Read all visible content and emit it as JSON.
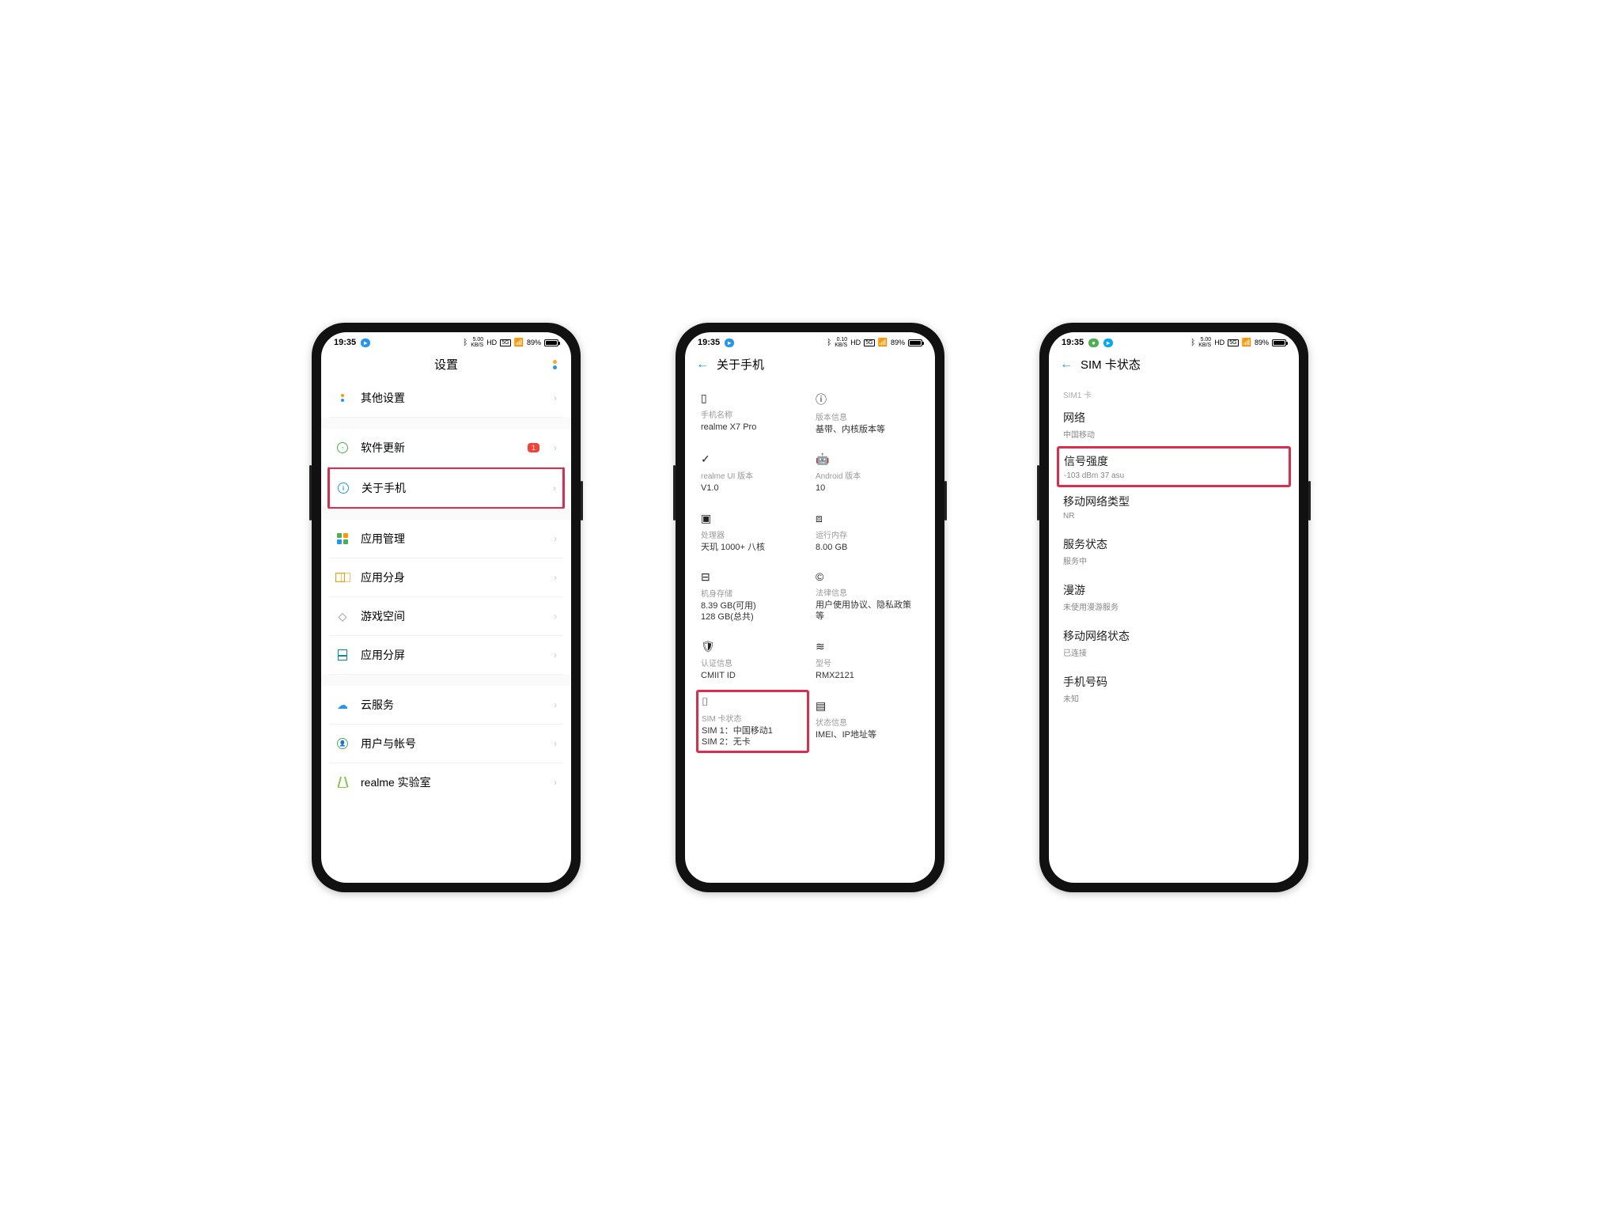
{
  "status": {
    "time": "19:35",
    "net_speed_top": "5.00",
    "net_speed_top_alt": "0.10",
    "net_speed_unit": "KB/S",
    "hd": "HD",
    "fiveg": "5G",
    "battery_pct": "89%"
  },
  "phone1": {
    "title": "设置",
    "rows": {
      "other": "其他设置",
      "update": "软件更新",
      "update_badge": "1",
      "about": "关于手机",
      "app_mgmt": "应用管理",
      "app_clone": "应用分身",
      "game_space": "游戏空间",
      "split_screen": "应用分屏",
      "cloud": "云服务",
      "accounts": "用户与帐号",
      "lab": "realme 实验室"
    }
  },
  "phone2": {
    "title": "关于手机",
    "cells": {
      "name_t": "手机名称",
      "name_v": "realme X7 Pro",
      "ver_t": "版本信息",
      "ver_v": "基带、内核版本等",
      "ui_t": "realme UI 版本",
      "ui_v": "V1.0",
      "android_t": "Android 版本",
      "android_v": "10",
      "cpu_t": "处理器",
      "cpu_v": "天玑 1000+ 八核",
      "ram_t": "运行内存",
      "ram_v": "8.00 GB",
      "storage_t": "机身存储",
      "storage_v1": "8.39 GB(可用)",
      "storage_v2": "128 GB(总共)",
      "legal_t": "法律信息",
      "legal_v": "用户使用协议、隐私政策等",
      "cert_t": "认证信息",
      "cert_v": "CMIIT ID",
      "model_t": "型号",
      "model_v": "RMX2121",
      "sim_t": "SIM 卡状态",
      "sim_v1": "SIM 1：中国移动1",
      "sim_v2": "SIM 2：无卡",
      "status_t": "状态信息",
      "status_v": "IMEI、IP地址等"
    }
  },
  "phone3": {
    "title": "SIM 卡状态",
    "section": "SIM1 卡",
    "items": {
      "network_k": "网络",
      "network_v": "中国移动",
      "signal_k": "信号强度",
      "signal_v": "-103 dBm 37 asu",
      "nettype_k": "移动网络类型",
      "nettype_v": "NR",
      "service_k": "服务状态",
      "service_v": "服务中",
      "roam_k": "漫游",
      "roam_v": "未使用漫游服务",
      "datastate_k": "移动网络状态",
      "datastate_v": "已连接",
      "phonenum_k": "手机号码",
      "phonenum_v": "未知"
    }
  }
}
